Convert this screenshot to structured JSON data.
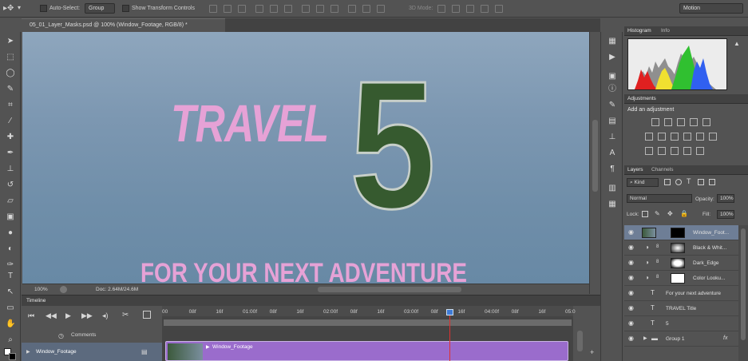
{
  "options_bar": {
    "auto_select_label": "Auto-Select:",
    "auto_select_value": "Group",
    "show_transform_label": "Show Transform Controls",
    "mode_3d_label": "3D Mode:",
    "workspace_value": "Motion"
  },
  "document": {
    "tab_title": "05_01_Layer_Masks.psd @ 100% (Window_Footage, RGB/8) *",
    "zoom": "100%",
    "doc_info": "Doc: 2.64M/24.6M"
  },
  "canvas": {
    "headline": "TRAVEL",
    "number": "5",
    "tagline": "FOR YOUR NEXT ADVENTURE"
  },
  "timeline": {
    "tab_label": "Timeline",
    "comments_label": "Comments",
    "track_name": "Window_Footage",
    "clip_name": "Window_Footage",
    "ticks": [
      "00",
      "08f",
      "16f",
      "01:00f",
      "08f",
      "16f",
      "02:00f",
      "08f",
      "16f",
      "03:00f",
      "08f",
      "16f",
      "04:00f",
      "08f",
      "16f",
      "05:0"
    ]
  },
  "panels": {
    "histogram_tabs": [
      "Histogram",
      "Info"
    ],
    "adjustments_tab": "Adjustments",
    "adjustments_hint": "Add an adjustment",
    "layers_tabs": [
      "Layers",
      "Channels"
    ],
    "kind_label": "Kind",
    "blend_mode": "Normal",
    "opacity_label": "Opacity:",
    "opacity_value": "100%",
    "lock_label": "Lock:",
    "fill_label": "Fill:",
    "fill_value": "100%"
  },
  "layers": [
    {
      "name": "Window_Foot...",
      "type": "video",
      "selected": true
    },
    {
      "name": "Black & Whit...",
      "type": "adjustment",
      "selected": false
    },
    {
      "name": "Dark_Edge",
      "type": "adjustment",
      "selected": false
    },
    {
      "name": "Color Looku...",
      "type": "adjustment",
      "selected": false
    },
    {
      "name": "For your next adventure",
      "type": "text",
      "selected": false
    },
    {
      "name": "TRAVEL Title",
      "type": "text",
      "selected": false
    },
    {
      "name": "5",
      "type": "text",
      "selected": false
    },
    {
      "name": "Group 1",
      "type": "group",
      "selected": false
    }
  ],
  "colors": {
    "ui_bg": "#535353",
    "accent_pink": "#e6a2d6",
    "five_green": "#365a2f",
    "clip_purple": "#9a6ccc",
    "playhead_red": "#e03030",
    "selected_layer": "#6e7e96"
  }
}
